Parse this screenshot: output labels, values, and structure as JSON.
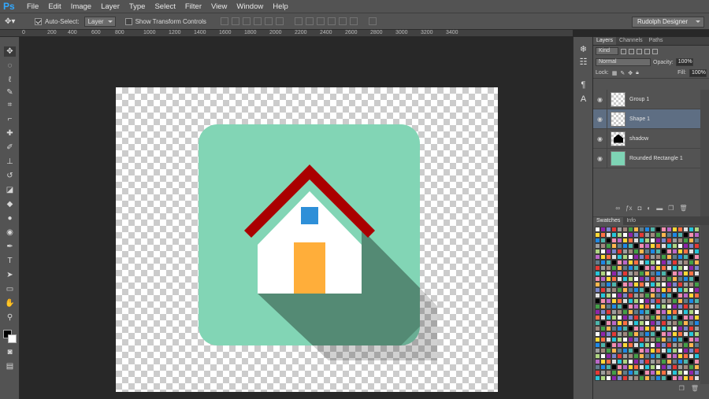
{
  "app": {
    "logo": "Ps"
  },
  "menu": [
    "File",
    "Edit",
    "Image",
    "Layer",
    "Type",
    "Select",
    "Filter",
    "View",
    "Window",
    "Help"
  ],
  "options": {
    "auto_select_label": "Auto-Select:",
    "auto_select_value": "Layer",
    "show_transform_label": "Show Transform Controls",
    "workspace": "Rudolph Designer"
  },
  "ruler_h": [
    "0",
    "200",
    "400",
    "600",
    "800",
    "1000",
    "1200",
    "1400",
    "1600",
    "1800",
    "2000",
    "2200",
    "2400",
    "2600",
    "2800",
    "3000",
    "3200",
    "3400"
  ],
  "panels": {
    "layers_tabs": [
      "Layers",
      "Channels",
      "Paths"
    ],
    "kind_label": "Kind",
    "blend_mode": "Normal",
    "opacity_label": "Opacity:",
    "opacity_value": "100%",
    "lock_label": "Lock:",
    "fill_label": "Fill:",
    "fill_value": "100%",
    "layers": [
      {
        "name": "Group 1",
        "thumb": "transparent"
      },
      {
        "name": "Shape 1",
        "thumb": "transparent"
      },
      {
        "name": "shadow",
        "thumb": "black"
      },
      {
        "name": "Rounded Rectangle 1",
        "thumb": "green"
      }
    ],
    "swatch_tabs": [
      "Swatches",
      "Info"
    ]
  },
  "icon_colors": {
    "background": "#82d5b5",
    "shadow": "#548a74",
    "roof": "#aa0000",
    "house": "#ffffff",
    "window": "#2e8fd8",
    "door": "#ffae3a"
  },
  "swatch_colors": [
    "#ffffff",
    "#000000",
    "#e53935",
    "#fdd835",
    "#43a047",
    "#26c6da",
    "#1e88e5",
    "#8e24aa",
    "#f48fb1",
    "#9e9e9e",
    "#ff7043",
    "#ffb74d",
    "#aed581",
    "#4db6ac",
    "#7986cb",
    "#ba68c8",
    "#a1887f",
    "#e0e0e0",
    "#607d8b"
  ]
}
